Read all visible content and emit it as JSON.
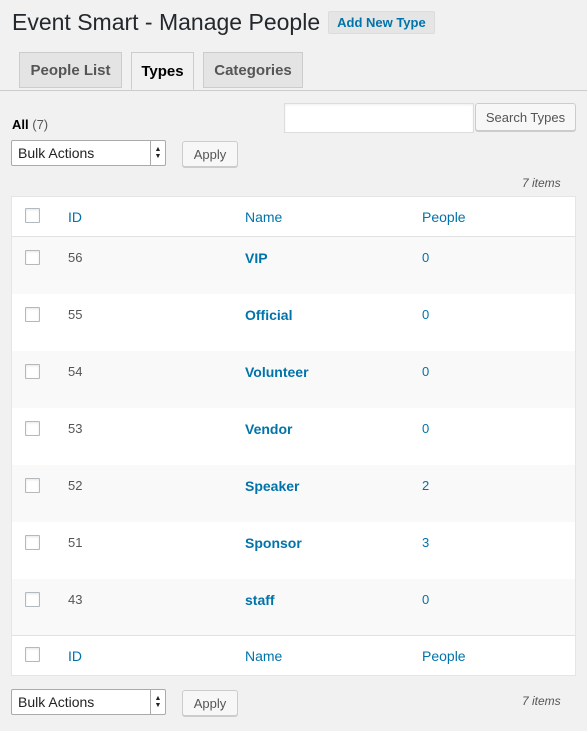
{
  "header": {
    "title": "Event Smart - Manage People",
    "add_new_label": "Add New Type"
  },
  "tabs": [
    {
      "label": "People List",
      "active": false
    },
    {
      "label": "Types",
      "active": true
    },
    {
      "label": "Categories",
      "active": false
    }
  ],
  "filters": {
    "all_label": "All",
    "all_count": "(7)"
  },
  "search": {
    "value": "",
    "placeholder": "",
    "button_label": "Search Types"
  },
  "bulk_top": {
    "selected": "Bulk Actions",
    "apply_label": "Apply"
  },
  "bulk_bottom": {
    "selected": "Bulk Actions",
    "apply_label": "Apply"
  },
  "items_count": "7 items",
  "table": {
    "columns": [
      "ID",
      "Name",
      "People"
    ],
    "rows": [
      {
        "id": "56",
        "name": "VIP",
        "people": "0"
      },
      {
        "id": "55",
        "name": "Official",
        "people": "0"
      },
      {
        "id": "54",
        "name": "Volunteer",
        "people": "0"
      },
      {
        "id": "53",
        "name": "Vendor",
        "people": "0"
      },
      {
        "id": "52",
        "name": "Speaker",
        "people": "2"
      },
      {
        "id": "51",
        "name": "Sponsor",
        "people": "3"
      },
      {
        "id": "43",
        "name": "staff",
        "people": "0"
      }
    ]
  },
  "colors": {
    "link": "#0073aa",
    "background": "#f1f1f1"
  }
}
